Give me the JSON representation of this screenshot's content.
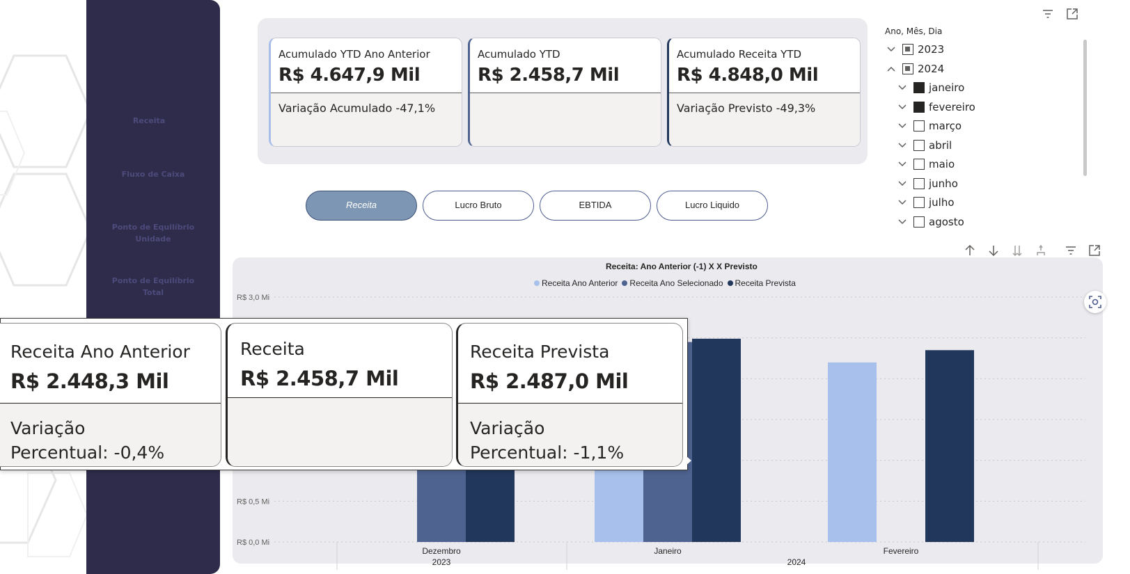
{
  "sidebar": {
    "items": [
      {
        "label": "Receita"
      },
      {
        "label": "Fluxo de Caixa"
      },
      {
        "label_line1": "Ponto de Equilíbrio",
        "label_line2": "Unidade"
      },
      {
        "label_line1": "Ponto de Equilíbrio",
        "label_line2": "Total"
      }
    ]
  },
  "kpis": [
    {
      "title": "Acumulado YTD Ano Anterior",
      "value": "R$ 4.647,9 Mil",
      "variation": "Variação Acumulado -47,1%"
    },
    {
      "title": "Acumulado YTD",
      "value": "R$ 2.458,7 Mil",
      "variation": ""
    },
    {
      "title": "Acumulado Receita YTD",
      "value": "R$ 4.848,0 Mil",
      "variation": "Variação Previsto -49,3%"
    }
  ],
  "toggles": [
    {
      "label": "Receita",
      "active": true
    },
    {
      "label": "Lucro Bruto",
      "active": false
    },
    {
      "label": "EBTIDA",
      "active": false
    },
    {
      "label": "Lucro Liquido",
      "active": false
    }
  ],
  "slicer": {
    "title": "Ano, Mês, Dia",
    "rows": [
      {
        "label": "2023",
        "state": "partial",
        "chevron": "down",
        "level": 0
      },
      {
        "label": "2024",
        "state": "partial",
        "chevron": "up",
        "level": 0
      },
      {
        "label": "janeiro",
        "state": "full",
        "chevron": "down",
        "level": 1
      },
      {
        "label": "fevereiro",
        "state": "full",
        "chevron": "down",
        "level": 1
      },
      {
        "label": "março",
        "state": "empty",
        "chevron": "down",
        "level": 1
      },
      {
        "label": "abril",
        "state": "empty",
        "chevron": "down",
        "level": 1
      },
      {
        "label": "maio",
        "state": "empty",
        "chevron": "down",
        "level": 1
      },
      {
        "label": "junho",
        "state": "empty",
        "chevron": "down",
        "level": 1
      },
      {
        "label": "julho",
        "state": "empty",
        "chevron": "down",
        "level": 1
      },
      {
        "label": "agosto",
        "state": "empty",
        "chevron": "down",
        "level": 1
      }
    ]
  },
  "chart_data": {
    "type": "bar",
    "title": "Receita: Ano Anterior (-1) X X Previsto",
    "series": [
      {
        "name": "Receita Ano Anterior",
        "color": "#a8c0ec",
        "values": [
          null,
          2.2,
          2.2
        ]
      },
      {
        "name": "Receita Ano Selecionado",
        "color": "#4e6390",
        "values": [
          2.45,
          2.45,
          null
        ]
      },
      {
        "name": "Receita Prevista",
        "color": "#22375c",
        "values": [
          2.49,
          2.49,
          2.35
        ]
      }
    ],
    "categories": [
      "Dezembro",
      "Janeiro",
      "Fevereiro"
    ],
    "year_labels": [
      "2023",
      "2024"
    ],
    "ylim": [
      0,
      3.0
    ],
    "y_ticks": [
      "R$ 0,0 Mi",
      "R$ 0,5 Mi",
      "R$ 3,0 Mi"
    ],
    "grid": true,
    "legend_position": "top-center"
  },
  "tooltip": {
    "cards": [
      {
        "title": "Receita Ano Anterior",
        "value": "R$ 2.448,3 Mil",
        "var_line1": "Variação",
        "var_line2": "Percentual: -0,4%"
      },
      {
        "title": "Receita",
        "value": "R$ 2.458,7 Mil",
        "var_line1": "",
        "var_line2": ""
      },
      {
        "title": "Receita Prevista",
        "value": "R$ 2.487,0 Mil",
        "var_line1": "Variação",
        "var_line2": "Percentual: -1,1%"
      }
    ]
  },
  "icons": {
    "slicer_filter": "filter-icon",
    "slicer_focus": "focus-mode-icon",
    "drill_up": "arrow-up-icon",
    "drill_down": "arrow-down-icon",
    "expand_all": "double-arrow-down-icon",
    "expand_hierarchy": "fork-icon",
    "visual_filter": "filter-icon",
    "visual_focus": "focus-mode-icon",
    "spotlight": "spotlight-icon"
  }
}
